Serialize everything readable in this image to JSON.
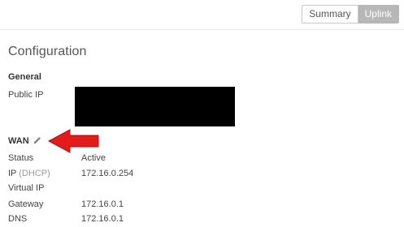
{
  "tabs": [
    {
      "label": "Summary",
      "active": false
    },
    {
      "label": "Uplink",
      "active": true
    }
  ],
  "page_title": "Configuration",
  "general": {
    "title": "General",
    "public_ip_label": "Public IP"
  },
  "wan": {
    "title": "WAN",
    "edit_icon": "pencil-icon",
    "rows": {
      "status": {
        "label": "Status",
        "value": "Active"
      },
      "ip": {
        "label": "IP",
        "label_sub": "(DHCP)",
        "value": "172.16.0.254"
      },
      "virtual_ip": {
        "label": "Virtual IP",
        "value": ""
      },
      "gateway": {
        "label": "Gateway",
        "value": "172.16.0.1"
      },
      "dns": {
        "label": "DNS",
        "value": "172.16.0.1"
      }
    }
  },
  "colors": {
    "active_tab": "#b7b7b7",
    "annotation_arrow": "#e31b1b",
    "redaction": "#000000"
  }
}
